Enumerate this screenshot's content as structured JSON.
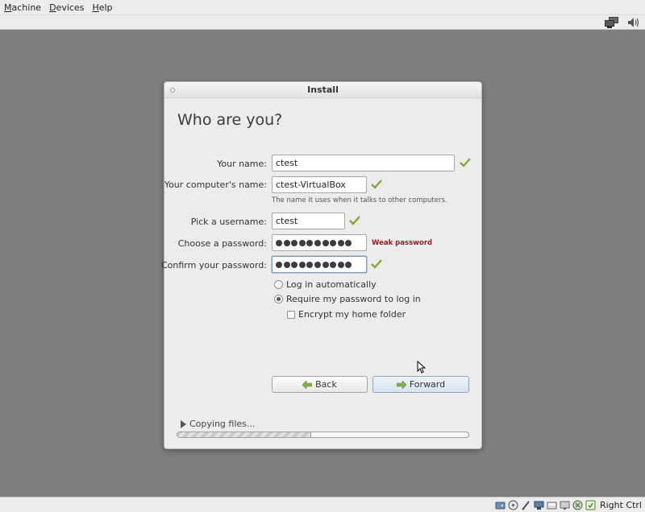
{
  "host_menu": [
    {
      "label": "Machine",
      "mnemonic": "M",
      "rest": "achine"
    },
    {
      "label": "Devices",
      "mnemonic": "D",
      "rest": "evices"
    },
    {
      "label": "Help",
      "mnemonic": "H",
      "rest": "elp"
    }
  ],
  "window": {
    "title": "Install"
  },
  "page": {
    "heading": "Who are you?",
    "name_label": "Your name:",
    "name_value": "ctest",
    "computer_label": "Your computer's name:",
    "computer_value": "ctest-VirtualBox",
    "computer_hint": "The name it uses when it talks to other computers.",
    "username_label": "Pick a username:",
    "username_value": "ctest",
    "password_label": "Choose a password:",
    "password_length": 10,
    "password_strength": "Weak password",
    "confirm_label": "Confirm your password:",
    "confirm_length": 10,
    "login_auto_label": "Log in automatically",
    "login_password_label": "Require my password to log in",
    "encrypt_label": "Encrypt my home folder",
    "selected_login": "require_password",
    "encrypt_checked": false
  },
  "buttons": {
    "back": "Back",
    "forward": "Forward"
  },
  "progress": {
    "label": "Copying files...",
    "fraction": 0.46
  },
  "statusbar": {
    "host_key": "Right Ctrl"
  },
  "colors": {
    "check": "#7fa834",
    "weak": "#a11b1b",
    "arrow": "#7fb43a"
  }
}
